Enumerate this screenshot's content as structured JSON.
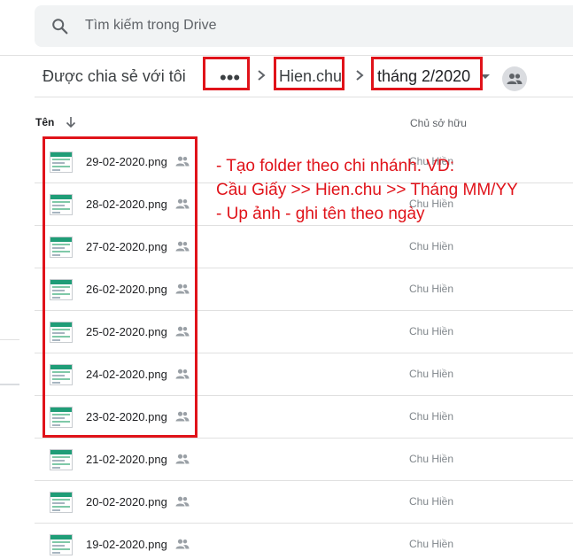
{
  "search": {
    "placeholder": "Tìm kiếm trong Drive"
  },
  "breadcrumb": {
    "root": "Được chia sẻ với tôi",
    "more": "•••",
    "folder": "Hien.chu",
    "current": "tháng 2/2020"
  },
  "columns": {
    "name": "Tên",
    "owner": "Chủ sở hữu"
  },
  "files": [
    {
      "name": "29-02-2020.png",
      "owner": "Chu Hiền"
    },
    {
      "name": "28-02-2020.png",
      "owner": "Chu Hiền"
    },
    {
      "name": "27-02-2020.png",
      "owner": "Chu Hiền"
    },
    {
      "name": "26-02-2020.png",
      "owner": "Chu Hiền"
    },
    {
      "name": "25-02-2020.png",
      "owner": "Chu Hiền"
    },
    {
      "name": "24-02-2020.png",
      "owner": "Chu Hiền"
    },
    {
      "name": "23-02-2020.png",
      "owner": "Chu Hiền"
    },
    {
      "name": "21-02-2020.png",
      "owner": "Chu Hiền"
    },
    {
      "name": "20-02-2020.png",
      "owner": "Chu Hiền"
    },
    {
      "name": "19-02-2020.png",
      "owner": "Chu Hiền"
    }
  ],
  "annotation": {
    "line1": "- Tạo folder theo chi nhánh. VD:",
    "line2": "Cầu Giấy >> Hien.chu >> Tháng MM/YY",
    "line3": "- Up ảnh - ghi tên theo ngày"
  },
  "colors": {
    "annotation": "#e0131a",
    "search_bg": "#f1f3f4"
  }
}
